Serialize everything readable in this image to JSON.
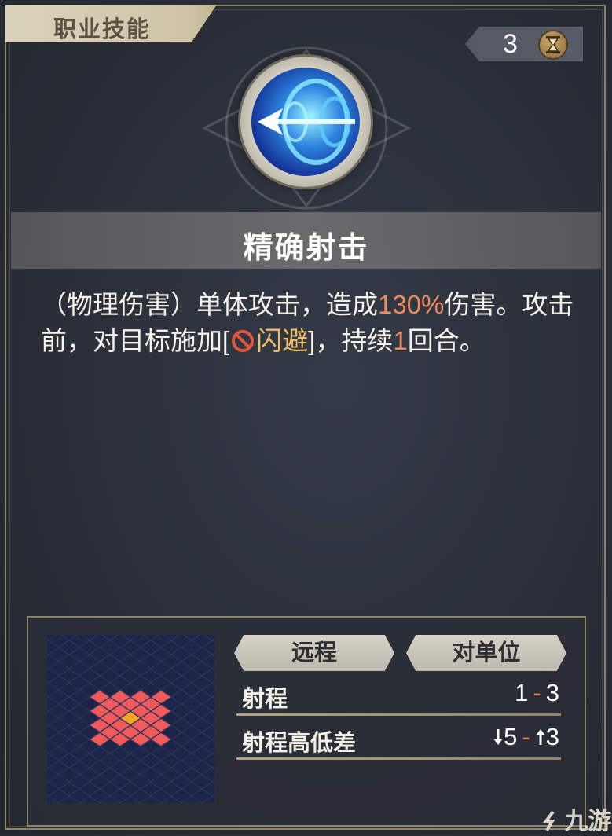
{
  "category_tab": {
    "label": "职业技能"
  },
  "cooldown": {
    "value": "3",
    "icon": "hourglass-icon"
  },
  "skill": {
    "icon": "arrow-shot-icon",
    "name": "精确射击",
    "description": {
      "p1": "（物理伤害）单体攻击，造成",
      "damage_pct": "130%",
      "p2": "伤害。攻击前，对目标施加[",
      "status_icon": "ban-icon",
      "status_name": "闪避",
      "p3": "]，持续",
      "duration": "1",
      "p4": "回合。"
    }
  },
  "info": {
    "tags": [
      "远程",
      "对单位"
    ],
    "range": {
      "label": "射程",
      "min": "1",
      "sep": "-",
      "max": "3"
    },
    "height_diff": {
      "label": "射程高低差",
      "down": "5",
      "sep": "-",
      "up": "3"
    }
  },
  "range_grid": {
    "center": [
      0,
      0
    ],
    "cells": [
      [
        0,
        -2
      ],
      [
        -1,
        -1
      ],
      [
        0,
        -1
      ],
      [
        1,
        -1
      ],
      [
        -2,
        0
      ],
      [
        -1,
        0
      ],
      [
        1,
        0
      ],
      [
        2,
        0
      ],
      [
        -1,
        1
      ],
      [
        0,
        1
      ],
      [
        1,
        1
      ],
      [
        0,
        2
      ],
      [
        -3,
        0
      ],
      [
        3,
        0
      ],
      [
        -2,
        -1
      ],
      [
        2,
        -1
      ],
      [
        -2,
        1
      ],
      [
        2,
        1
      ],
      [
        -1,
        -2
      ],
      [
        1,
        -2
      ],
      [
        -1,
        2
      ],
      [
        1,
        2
      ],
      [
        0,
        -3
      ],
      [
        0,
        3
      ]
    ]
  },
  "watermark": {
    "text": "九游"
  },
  "colors": {
    "accent_orange": "#ef8a5d",
    "accent_gold": "#f0c067",
    "frame_gold": "#8f8466",
    "grid_bg": "#1d2547",
    "tile_red": "#f05a5a",
    "tile_center": "#f5a623"
  }
}
